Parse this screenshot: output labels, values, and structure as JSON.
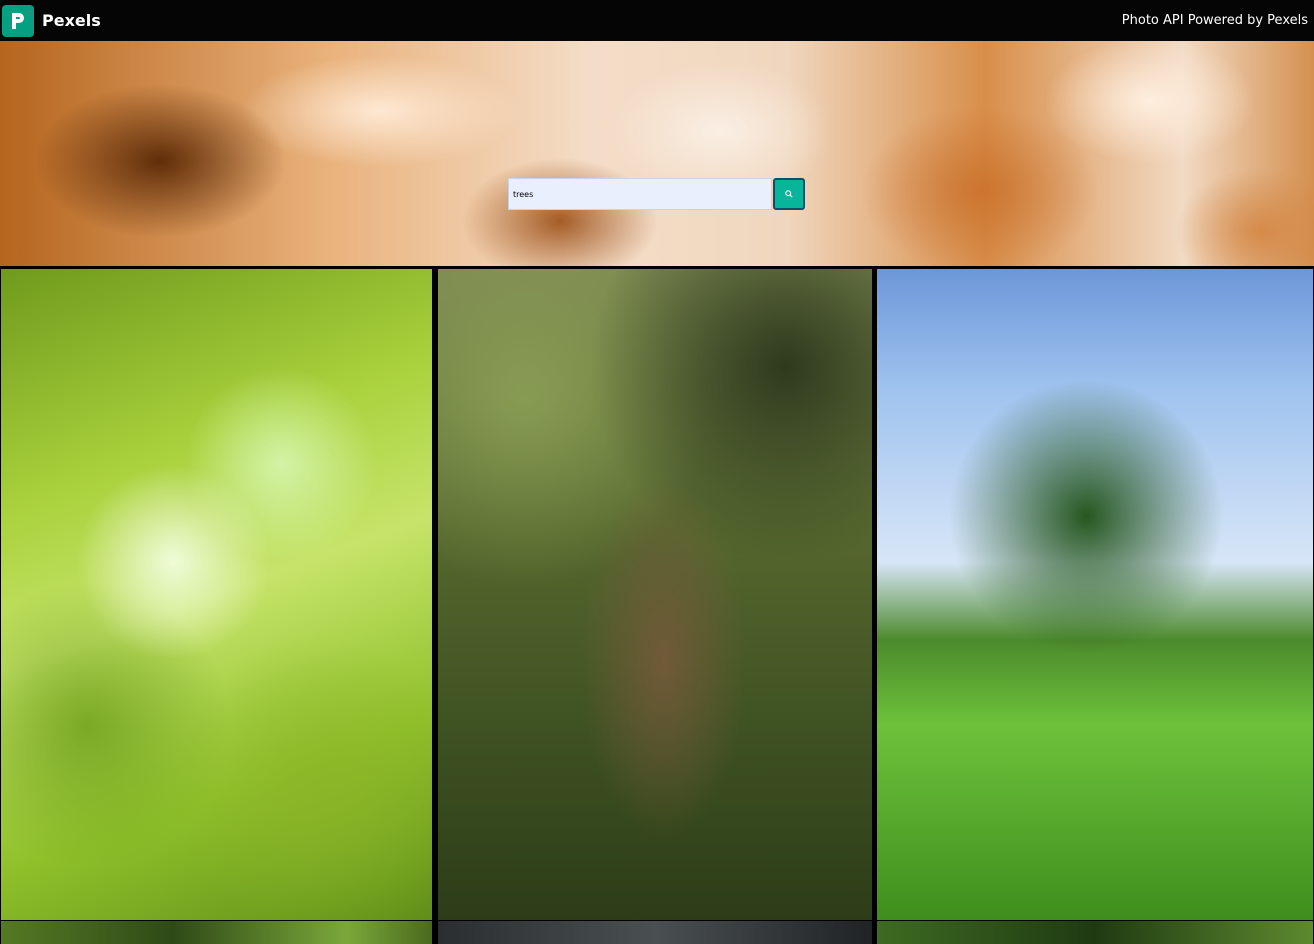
{
  "header": {
    "brand_name": "Pexels",
    "logo_icon": "pexels-logo-icon",
    "api_link": "Photo API Powered by Pexels"
  },
  "search": {
    "value": "trees",
    "button_icon": "search-icon"
  },
  "colors": {
    "brand_green": "#05a081",
    "search_button": "#06b59a",
    "topbar": "#050505"
  }
}
